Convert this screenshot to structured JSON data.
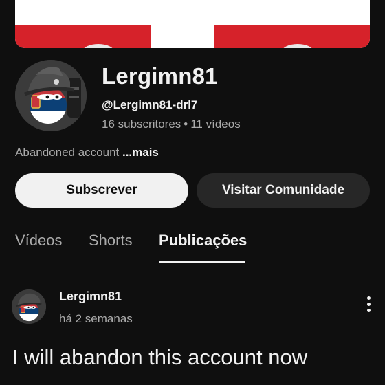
{
  "channel": {
    "name": "Lergimn81",
    "handle": "@Lergimn81-drl7",
    "subscribers": "16 subscritores",
    "separator": "•",
    "videos": "11 vídeos",
    "description": "Abandoned account ",
    "more_label": "...mais"
  },
  "actions": {
    "subscribe_label": "Subscrever",
    "community_label": "Visitar Comunidade"
  },
  "tabs": [
    {
      "label": "Vídeos",
      "active": false
    },
    {
      "label": "Shorts",
      "active": false
    },
    {
      "label": "Publicações",
      "active": true
    }
  ],
  "post": {
    "author": "Lergimn81",
    "time": "há 2 semanas",
    "text": "I will abandon this account now",
    "menu_icon": "more-vert-icon"
  },
  "colors": {
    "background": "#0f0f0f",
    "banner_red": "#d6222a",
    "subscribe_bg": "#f1f1f1",
    "secondary_button_bg": "#272727",
    "muted_text": "#aaaaaa"
  }
}
